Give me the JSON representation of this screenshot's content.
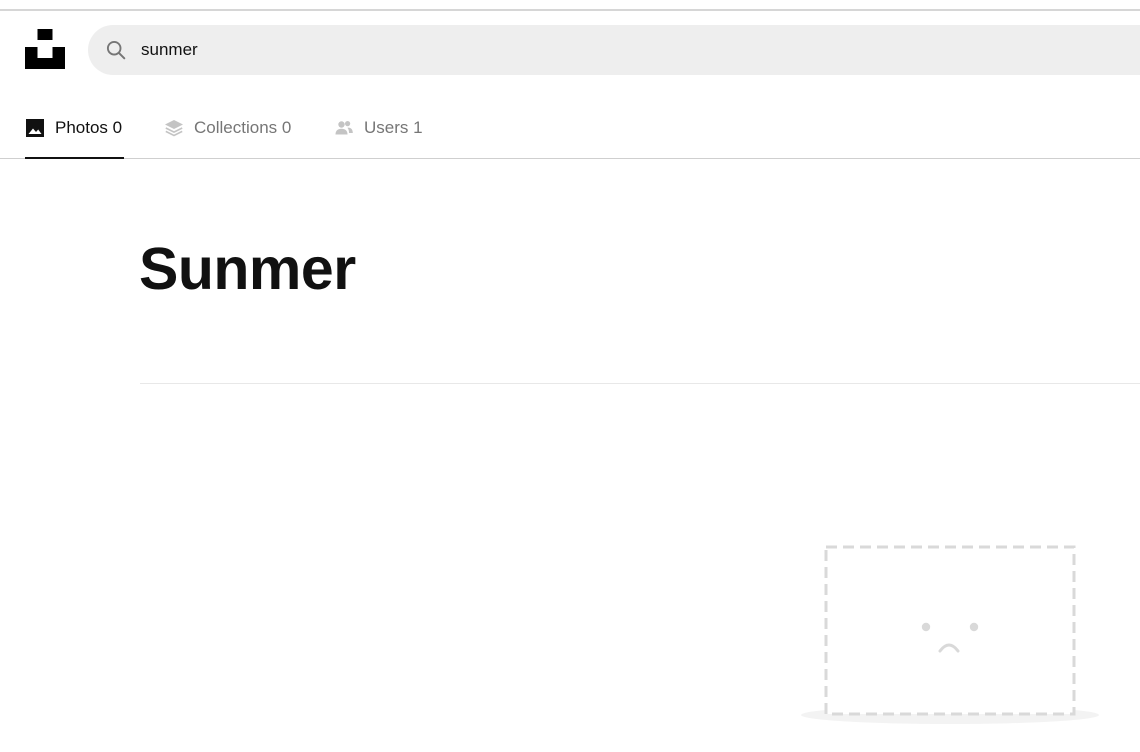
{
  "search": {
    "value": "sunmer",
    "icon": "search-icon"
  },
  "tabs": [
    {
      "label": "Photos 0",
      "icon": "image-icon",
      "active": true
    },
    {
      "label": "Collections 0",
      "icon": "layers-icon",
      "active": false
    },
    {
      "label": "Users 1",
      "icon": "users-icon",
      "active": false
    }
  ],
  "main": {
    "title": "Sunmer"
  },
  "colors": {
    "accent": "#111111",
    "muted": "#767676",
    "search_bg": "#eeeeee",
    "illustration": "#d9d9d9"
  }
}
